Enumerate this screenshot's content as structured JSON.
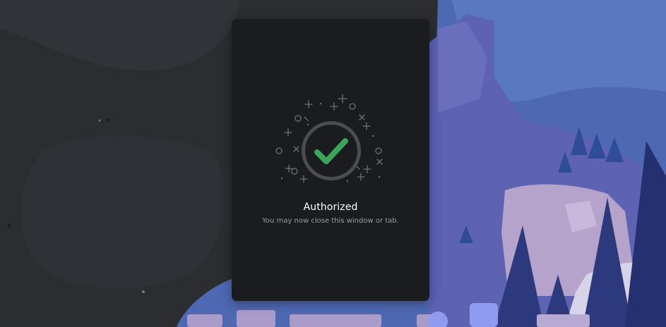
{
  "auth": {
    "title": "Authorized",
    "message": "You may now close this window or tab."
  },
  "icons": {
    "status": "checkmark-icon"
  },
  "colors": {
    "background": "#2b2d31",
    "modal": "#1b1c20",
    "success": "#3ba55c",
    "ring": "#4b4d52",
    "scenery_sky": "#5a72bd",
    "scenery_trees": "#2c3a7d"
  }
}
